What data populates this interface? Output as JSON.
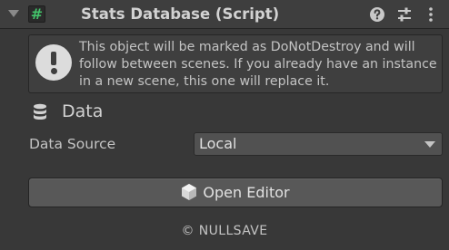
{
  "component": {
    "title": "Stats Database (Script)",
    "script_glyph": "#",
    "colors": {
      "background": "#383838",
      "header": "#3e3e3e",
      "script_icon": "#43c26a",
      "text": "#c4c4c4"
    },
    "header_icons": [
      "help-icon",
      "presets-sliders-icon",
      "context-menu-icon"
    ]
  },
  "helpbox": {
    "icon": "warning-exclamation-icon",
    "text": "This object will be marked as DoNotDestroy and will follow between scenes. If you already have an instance in a new scene, this one will replace it."
  },
  "data_section": {
    "icon": "database-icon",
    "title": "Data",
    "field_label": "Data Source",
    "field_value": "Local"
  },
  "editor_button": {
    "icon": "hexagon-icon",
    "label": "Open Editor"
  },
  "footer": {
    "text": "© NULLSAVE"
  }
}
